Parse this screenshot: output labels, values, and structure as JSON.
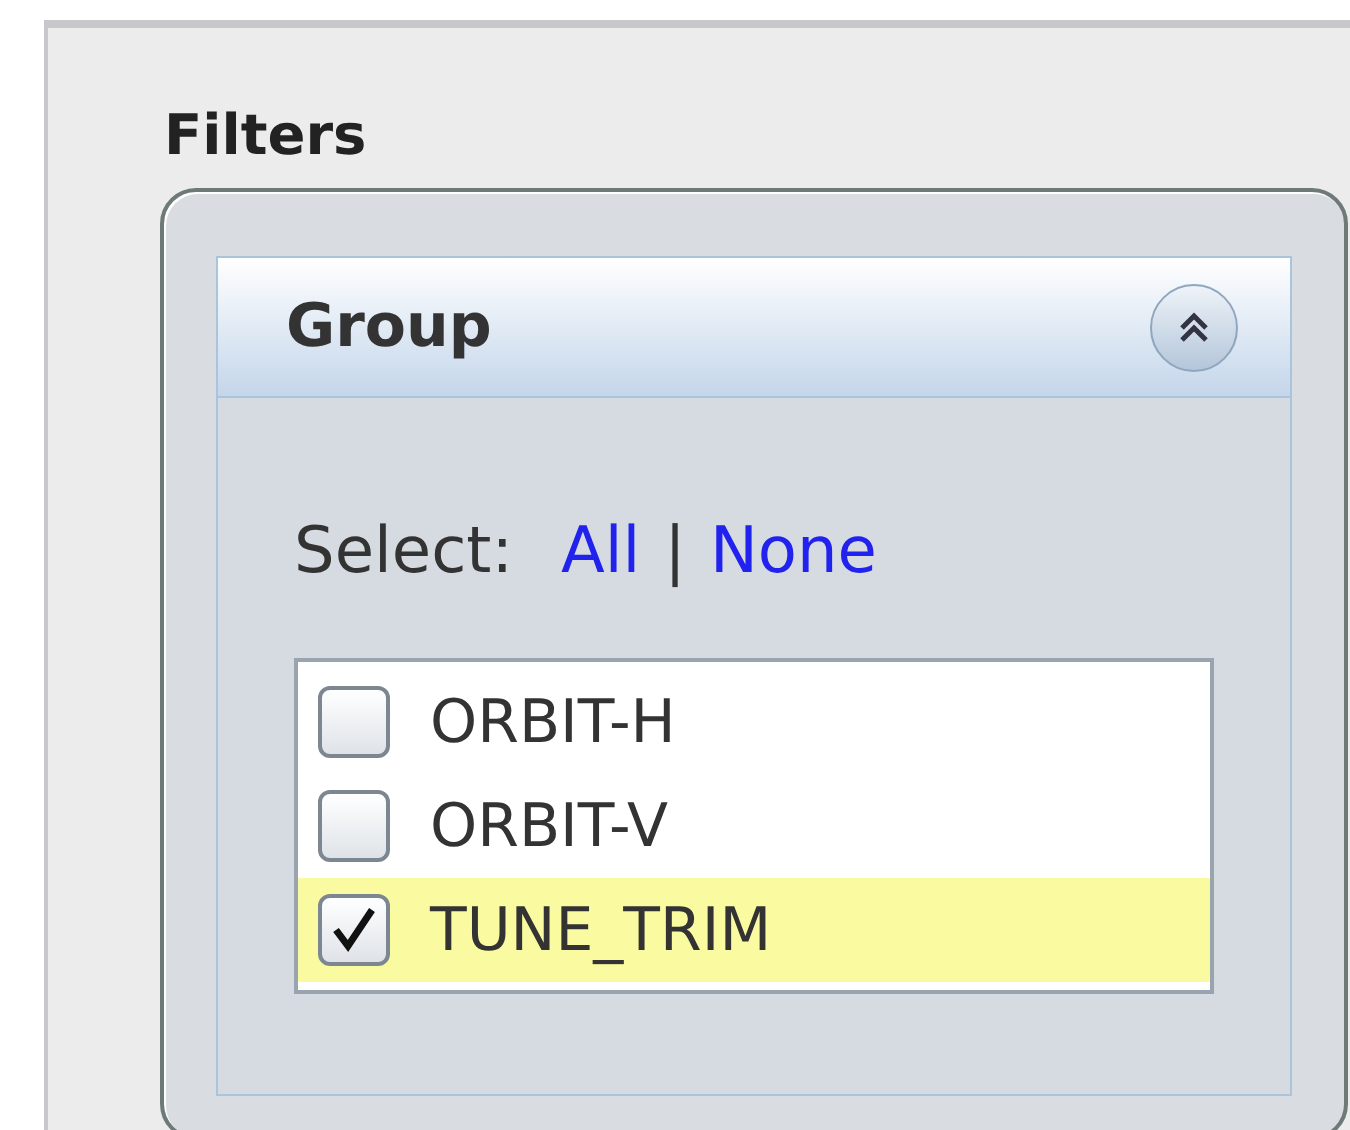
{
  "section_title": "Filters",
  "group_panel": {
    "title": "Group",
    "expanded": true,
    "select_label": "Select:",
    "links": [
      "All",
      "None"
    ],
    "separator": "|",
    "items": [
      {
        "label": "ORBIT-H",
        "checked": false,
        "selected": false
      },
      {
        "label": "ORBIT-V",
        "checked": false,
        "selected": false
      },
      {
        "label": "TUNE_TRIM",
        "checked": true,
        "selected": true
      }
    ]
  }
}
